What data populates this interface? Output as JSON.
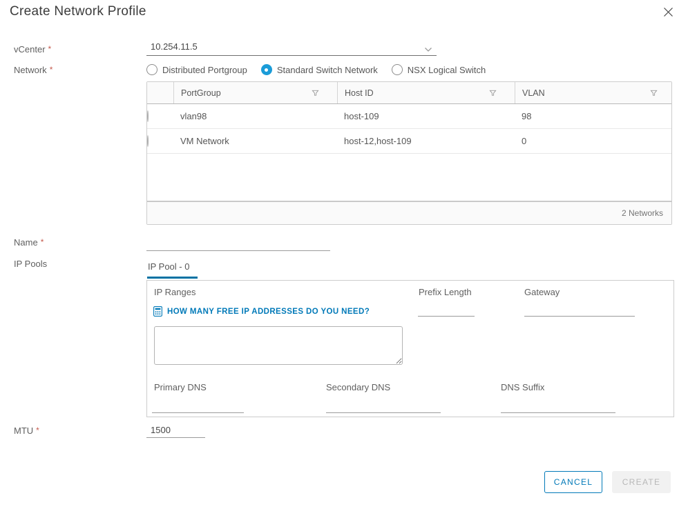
{
  "colors": {
    "accent": "#0079b8",
    "radio_selected": "#1b9cd8",
    "tab_active": "#0072a3",
    "required_asterisk": "#c55a4d",
    "link": "#0079b8"
  },
  "required_marker": "*",
  "dialog": {
    "title": "Create Network Profile"
  },
  "form": {
    "vcenter_label": "vCenter",
    "vcenter_value": "10.254.11.5",
    "network_label": "Network",
    "network_options": [
      {
        "label": "Distributed Portgroup",
        "selected": false
      },
      {
        "label": "Standard Switch Network",
        "selected": true
      },
      {
        "label": "NSX Logical Switch",
        "selected": false
      }
    ],
    "name_label": "Name",
    "name_value": "",
    "ip_pools_label": "IP Pools",
    "mtu_label": "MTU",
    "mtu_value": "1500"
  },
  "network_table": {
    "columns": [
      "PortGroup",
      "Host ID",
      "VLAN"
    ],
    "rows": [
      {
        "portgroup": "vlan98",
        "host_id": "host-109",
        "vlan": "98",
        "selected": false
      },
      {
        "portgroup": "VM Network",
        "host_id": "host-12,host-109",
        "vlan": "0",
        "selected": false
      }
    ],
    "footer_count": "2 Networks"
  },
  "ip_pool": {
    "tab_label": "IP Pool - 0",
    "ip_ranges_label": "IP Ranges",
    "calculator_link_label": "HOW MANY FREE IP ADDRESSES DO YOU NEED?",
    "ip_ranges_value": "",
    "prefix_length_label": "Prefix Length",
    "prefix_length_value": "",
    "gateway_label": "Gateway",
    "gateway_value": "",
    "primary_dns_label": "Primary DNS",
    "primary_dns_value": "",
    "secondary_dns_label": "Secondary DNS",
    "secondary_dns_value": "",
    "dns_suffix_label": "DNS Suffix",
    "dns_suffix_value": ""
  },
  "actions": {
    "cancel_label": "CANCEL",
    "create_label": "CREATE"
  }
}
